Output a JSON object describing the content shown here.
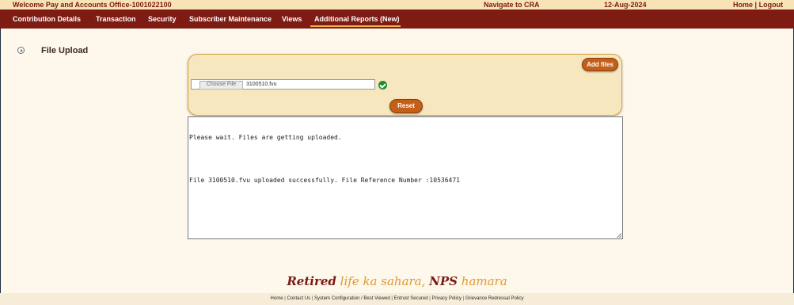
{
  "topbar": {
    "welcome": "Welcome Pay and Accounts Office-1001022100",
    "navigate_cra": "Navigate to CRA",
    "date": "12-Aug-2024",
    "home": "Home",
    "sep": "|",
    "logout": "Logout"
  },
  "nav": {
    "items": [
      {
        "label": "Contribution Details"
      },
      {
        "label": "Transaction"
      },
      {
        "label": "Security"
      },
      {
        "label": "Subscriber Maintenance"
      },
      {
        "label": "Views"
      },
      {
        "label": "Additional Reports (New)"
      }
    ],
    "active_index": 5
  },
  "page": {
    "title": "File Upload"
  },
  "upload": {
    "add_files_label": "Add files",
    "choose_file_label": "Choose File",
    "file_name": "3100510.fvu",
    "reset_label": "Reset",
    "status_icon": "check-circle-icon"
  },
  "log": {
    "lines": [
      "Please wait. Files are getting uploaded.",
      "",
      "File 3100510.fvu uploaded successfully. File Reference Number :10536471"
    ]
  },
  "tagline": {
    "part1": "Retired",
    "part2": "life ka sahara, ",
    "part3": "NPS",
    "part4": "hamara"
  },
  "footer": {
    "links": [
      "Home",
      "Contact Us",
      "System Configuration / Best Viewed",
      "Entrust Secured",
      "Privacy Policy",
      "Grievance Redressal Policy"
    ],
    "sep": "|"
  },
  "colors": {
    "nav_bg": "#7e1c13",
    "topbar_bg": "#f7e3b5",
    "accent_orange": "#c45f1a",
    "page_bg": "#fdf7ec"
  }
}
